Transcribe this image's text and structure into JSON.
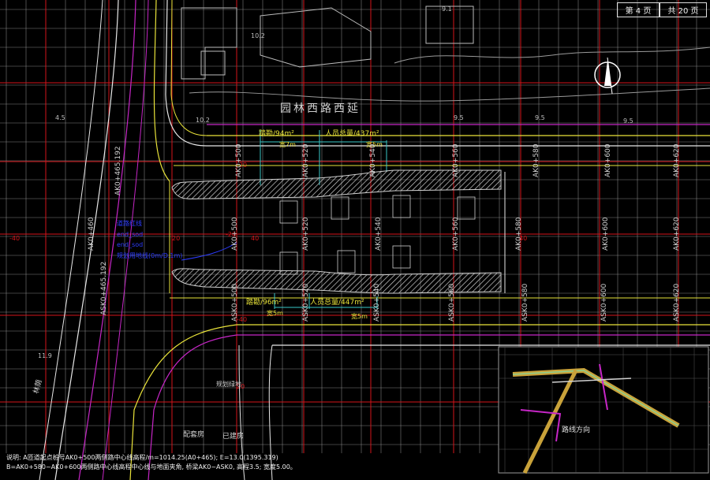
{
  "title_block": {
    "sheet": "第 4 页",
    "total": "共 20 页"
  },
  "road_name": "园林西路西延",
  "grid": {
    "red_labels": [
      "-40",
      "-20",
      "20",
      "40",
      "-40",
      "-20",
      "20",
      "40"
    ]
  },
  "stations": {
    "upper": [
      "AK0+500",
      "AK0+520",
      "AK0+540",
      "AK0+560",
      "AK0+580",
      "AK0+600",
      "AK0+620"
    ],
    "middle": [
      "AK0+500",
      "AK0+520",
      "AK0+540",
      "AK0+560",
      "AK0+580",
      "AK0+600",
      "AK0+620"
    ],
    "lower": [
      "ASK0+500",
      "ASK0+520",
      "ASK0+540",
      "ASK0+560",
      "ASK0+580",
      "ASK0+600",
      "ASK0+620"
    ],
    "left_upper": "AK0+465.192",
    "left_lower": "ASK0+465.192",
    "left_mid": "AK0+460"
  },
  "areas": {
    "top_left": "踏勘/94m²",
    "top_right": "人员总量/437m²",
    "top_w1": "宽7m",
    "top_w2": "宽5m",
    "bottom_left": "踏勘/96m²",
    "bottom_right": "人员总量/447m²",
    "bottom_w1": "宽5m",
    "bottom_w2": "宽5m"
  },
  "legend_blue": [
    "道路红线",
    "end_sod",
    "end_sod",
    "规划用地线(0m/D.1m)"
  ],
  "elevations": [
    "10.2",
    "9.5",
    "9.5",
    "9.5",
    "4.5",
    "11.9",
    "10.2",
    "9.1"
  ],
  "labels": {
    "left_road": "林荫",
    "lower_a": "规划绿地",
    "lower_b": "配套房",
    "lower_c": "已建房",
    "inset_label": "路线方向"
  },
  "notes": [
    "说明: A匝道起点桩号AK0+500两侧路中心线高程/m=1014.25(A0+465); E=13.0(1395.319)",
    "B=AK0+580~AK0+600两侧路中心线高程中心线与地面夹角, 桥梁AK0~ASK0, 高程3.5; 宽度5.00。"
  ],
  "colors": {
    "grid": "#a7a7a7",
    "grid_red": "#d4141a",
    "road_yellow": "#e9e33a",
    "road_magenta": "#c626c6",
    "road_white": "#e8e8e8",
    "cyan": "#39c8c8",
    "blue": "#2d3cff",
    "hatch": "#cfcfcf"
  }
}
